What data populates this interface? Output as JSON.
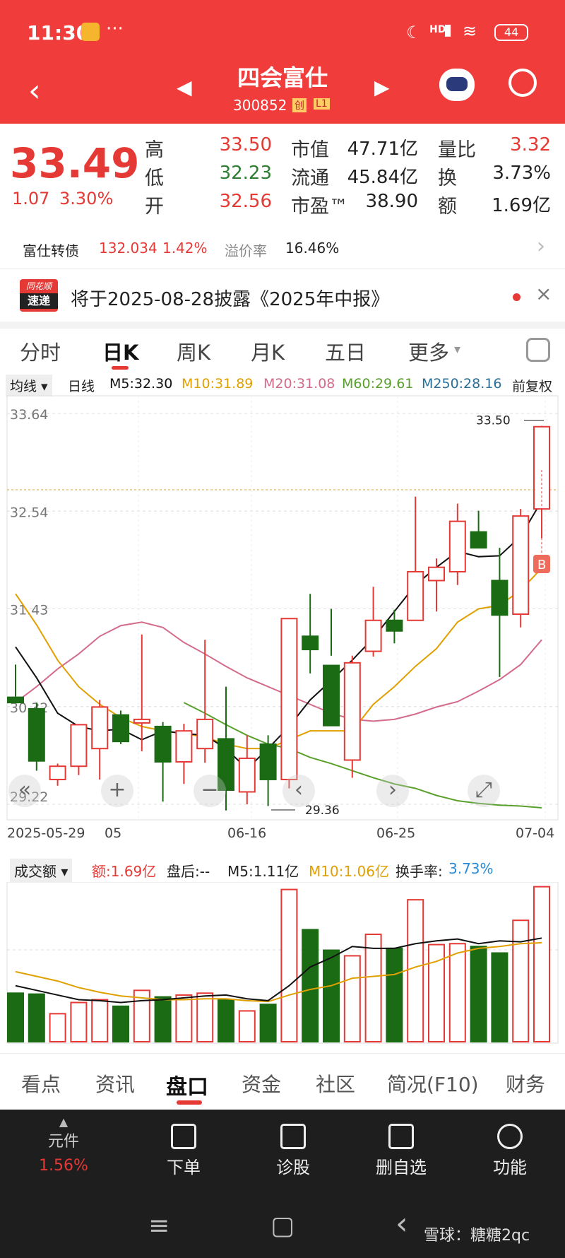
{
  "status": {
    "time": "11:30",
    "dots": "···",
    "network": "HD",
    "battery": "44"
  },
  "header": {
    "title": "四会富仕",
    "code": "300852",
    "badge1": "创",
    "badge2": "L1"
  },
  "quote": {
    "price": "33.49",
    "change": "1.07",
    "change_pct": "3.30%",
    "rows": [
      {
        "l1": "高",
        "v1": "33.50",
        "l2": "市值",
        "v2": "47.71亿",
        "l3": "量比",
        "v3": "3.32"
      },
      {
        "l1": "低",
        "v1": "32.23",
        "l2": "流通",
        "v2": "45.84亿",
        "l3": "换",
        "v3": "3.73%"
      },
      {
        "l1": "开",
        "v1": "32.56",
        "l2": "市盈™",
        "v2": "38.90",
        "l3": "额",
        "v3": "1.69亿"
      }
    ]
  },
  "bond": {
    "name": "富仕转债",
    "price": "132.034",
    "pct": "1.42%",
    "premium_label": "溢价率",
    "premium": "16.46%"
  },
  "notice": {
    "logo_top": "同花顺",
    "logo_bottom": "速递",
    "text": "将于2025-08-28披露《2025年中报》"
  },
  "ktabs": [
    "分时",
    "日K",
    "周K",
    "月K",
    "五日",
    "更多"
  ],
  "legend": {
    "ma_type": "均线",
    "period": "日线",
    "m5": "M5:32.30",
    "m10": "M10:31.89",
    "m20": "M20:31.08",
    "m60": "M60:29.61",
    "m250": "M250:28.16",
    "adjust": "前复权"
  },
  "colors": {
    "up": "#e53935",
    "down": "#1b6b14",
    "m5": "#111111",
    "m10": "#e0a000",
    "m20": "#d36b8a",
    "m60": "#5aa02c",
    "m250": "#2a6f97"
  },
  "chart_data": {
    "type": "candlestick",
    "y_ticks": [
      "33.64",
      "32.54",
      "31.43",
      "30.32",
      "29.22"
    ],
    "x_ticks": [
      "2025-05-29",
      "05",
      "06-16",
      "06-25",
      "07-04"
    ],
    "high_label": "33.50",
    "low_label": "29.36",
    "buy_marker": "B",
    "ylim": [
      29.22,
      33.64
    ],
    "candles": [
      {
        "o": 30.43,
        "h": 30.8,
        "l": 30.37,
        "c": 30.37
      },
      {
        "o": 30.3,
        "h": 30.37,
        "l": 29.6,
        "c": 29.71
      },
      {
        "o": 29.5,
        "h": 29.68,
        "l": 29.43,
        "c": 29.65
      },
      {
        "o": 29.65,
        "h": 30.05,
        "l": 29.55,
        "c": 30.12
      },
      {
        "o": 29.85,
        "h": 30.4,
        "l": 29.5,
        "c": 30.32
      },
      {
        "o": 30.23,
        "h": 30.28,
        "l": 29.9,
        "c": 29.93
      },
      {
        "o": 30.14,
        "h": 31.14,
        "l": 29.82,
        "c": 30.18
      },
      {
        "o": 30.1,
        "h": 30.15,
        "l": 29.25,
        "c": 29.7
      },
      {
        "o": 29.7,
        "h": 30.13,
        "l": 29.45,
        "c": 30.05
      },
      {
        "o": 29.85,
        "h": 31.08,
        "l": 29.69,
        "c": 30.18
      },
      {
        "o": 29.96,
        "h": 30.55,
        "l": 29.15,
        "c": 29.38
      },
      {
        "o": 29.36,
        "h": 30.0,
        "l": 29.22,
        "c": 29.74
      },
      {
        "o": 29.9,
        "h": 30.0,
        "l": 29.2,
        "c": 29.5
      },
      {
        "o": 29.5,
        "h": 31.3,
        "l": 29.4,
        "c": 31.32
      },
      {
        "o": 31.12,
        "h": 31.6,
        "l": 30.7,
        "c": 30.97
      },
      {
        "o": 30.79,
        "h": 31.43,
        "l": 30.9,
        "c": 30.11
      },
      {
        "o": 29.72,
        "h": 30.9,
        "l": 29.52,
        "c": 30.82
      },
      {
        "o": 30.95,
        "h": 31.68,
        "l": 30.89,
        "c": 31.3
      },
      {
        "o": 31.3,
        "h": 31.42,
        "l": 31.04,
        "c": 31.18
      },
      {
        "o": 31.3,
        "h": 32.7,
        "l": 31.3,
        "c": 31.85
      },
      {
        "o": 31.75,
        "h": 32.0,
        "l": 31.4,
        "c": 31.9
      },
      {
        "o": 31.85,
        "h": 32.62,
        "l": 31.7,
        "c": 32.42
      },
      {
        "o": 32.3,
        "h": 32.54,
        "l": 32.14,
        "c": 32.12
      },
      {
        "o": 31.75,
        "h": 32.12,
        "l": 30.66,
        "c": 31.36
      },
      {
        "o": 31.37,
        "h": 32.56,
        "l": 31.22,
        "c": 32.48
      },
      {
        "o": 32.56,
        "h": 33.5,
        "l": 32.23,
        "c": 33.49
      }
    ],
    "ma": {
      "m5": [
        31.0,
        30.65,
        30.25,
        30.1,
        30.05,
        30.07,
        29.95,
        30.05,
        30.02,
        30.0,
        29.85,
        29.62,
        29.85,
        30.1,
        30.4,
        30.62,
        30.85,
        31.1,
        31.4,
        31.7,
        31.9,
        32.08,
        32.02,
        32.03,
        32.25,
        32.65
      ],
      "m10": [
        31.6,
        31.25,
        30.85,
        30.55,
        30.35,
        30.2,
        30.1,
        30.05,
        30.02,
        29.98,
        29.9,
        29.85,
        29.85,
        29.95,
        30.05,
        30.05,
        30.05,
        30.35,
        30.55,
        30.78,
        30.98,
        31.28,
        31.43,
        31.47,
        31.64,
        31.89
      ],
      "m20": [
        30.37,
        30.55,
        30.75,
        30.92,
        31.12,
        31.24,
        31.28,
        31.22,
        31.05,
        30.92,
        30.78,
        30.65,
        30.55,
        30.45,
        30.35,
        30.25,
        30.18,
        30.16,
        30.18,
        30.24,
        30.32,
        30.38,
        30.5,
        30.63,
        30.8,
        31.08
      ],
      "m60": [
        30.37,
        30.25,
        30.12,
        30.0,
        29.9,
        29.85,
        29.75,
        29.68,
        29.6,
        29.52,
        29.45,
        29.4,
        29.32,
        29.26,
        29.23,
        29.21,
        29.2,
        29.18
      ],
      "m250": []
    }
  },
  "controls": {
    "zoom_out": "«",
    "zoom_in": "+",
    "minus": "−",
    "left": "‹",
    "right": "›",
    "fullscreen": "⤢"
  },
  "vol_legend": {
    "type": "成交额",
    "amount": "额:1.69亿",
    "after": "盘后:--",
    "m5": "M5:1.11亿",
    "m10": "M10:1.06亿",
    "turnover_label": "换手率:",
    "turnover": "3.73%"
  },
  "volume_data": {
    "values": [
      0.52,
      0.51,
      0.3,
      0.42,
      0.45,
      0.38,
      0.55,
      0.48,
      0.5,
      0.52,
      0.45,
      0.33,
      0.4,
      1.63,
      1.2,
      0.98,
      0.92,
      1.15,
      1.0,
      1.52,
      1.04,
      1.05,
      1.02,
      0.95,
      1.3,
      1.66
    ],
    "m5": [
      0.6,
      0.55,
      0.5,
      0.45,
      0.44,
      0.42,
      0.44,
      0.45,
      0.47,
      0.49,
      0.5,
      0.46,
      0.44,
      0.6,
      0.8,
      0.9,
      1.02,
      1.0,
      1.0,
      1.05,
      1.08,
      1.1,
      1.05,
      1.08,
      1.07,
      1.11
    ],
    "m10": [
      0.75,
      0.7,
      0.65,
      0.58,
      0.53,
      0.49,
      0.47,
      0.45,
      0.45,
      0.46,
      0.46,
      0.44,
      0.43,
      0.5,
      0.56,
      0.6,
      0.68,
      0.7,
      0.72,
      0.8,
      0.86,
      0.95,
      1.0,
      1.02,
      1.05,
      1.06
    ]
  },
  "bottabs": [
    "看点",
    "资讯",
    "盘口",
    "资金",
    "社区",
    "简况(F10)",
    "财务"
  ],
  "toolbar": {
    "first_label": "元件",
    "first_pct": "1.56%",
    "items": [
      "下单",
      "诊股",
      "删自选",
      "功能"
    ]
  },
  "navbar": {
    "menu": "≡",
    "home": "▢",
    "back": "‹",
    "watermark": "雪球：糖糖2qc"
  }
}
